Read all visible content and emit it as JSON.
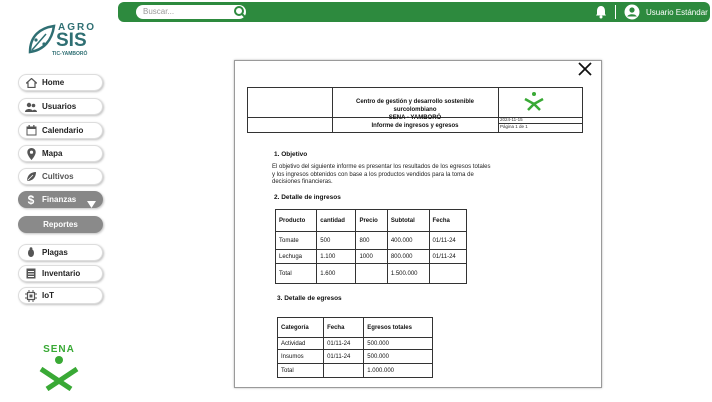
{
  "topbar": {
    "search_placeholder": "Buscar...",
    "user_name": "Usuario Estándar",
    "accent_color": "#2d8a3e"
  },
  "logo": {
    "agro": "AGRO",
    "sis": "SIS",
    "tic": "TIC-YAMBORÓ"
  },
  "sidebar": {
    "items": [
      {
        "label": "Home",
        "icon": "home-icon"
      },
      {
        "label": "Usuarios",
        "icon": "users-icon"
      },
      {
        "label": "Calendario",
        "icon": "calendar-icon"
      },
      {
        "label": "Mapa",
        "icon": "map-pin-icon"
      },
      {
        "label": "Cultivos",
        "icon": "leaf-icon"
      },
      {
        "label": "Finanzas",
        "icon": "dollar-icon"
      },
      {
        "label": "Reportes",
        "icon": ""
      },
      {
        "label": "Plagas",
        "icon": "bug-icon"
      },
      {
        "label": "Inventario",
        "icon": "inventory-icon"
      },
      {
        "label": "IoT",
        "icon": "chip-icon"
      }
    ]
  },
  "sena_logo_text": "SENA",
  "document": {
    "header_center": "Centro de gestión y desarrollo sostenible surcolombiano",
    "header_center2": "SENA - YAMBORÓ",
    "header_report": "Informe de ingresos y egresos",
    "header_date": "2024-11-15",
    "header_page": "Página 1 de 1",
    "sec1_title": "1. Objetivo",
    "sec1_text": "El objetivo del siguiente informe es presentar los resultados de los egresos totales y los ingresos obtenidos con base a los productos vendidos para la toma de decisiones financieras.",
    "sec2_title": "2. Detalle de ingresos",
    "ingresos": {
      "headers": [
        "Producto",
        "cantidad",
        "Precio",
        "Subtotal",
        "Fecha"
      ],
      "rows": [
        [
          "Tomate",
          "500",
          "800",
          "400.000",
          "01/11-24"
        ],
        [
          "Lechuga",
          "1.100",
          "1000",
          "800.000",
          "01/11-24"
        ],
        [
          "Total",
          "1.600",
          "",
          "1.500.000",
          ""
        ]
      ]
    },
    "sec3_title": "3. Detalle de egresos",
    "egresos": {
      "headers": [
        "Categoría",
        "Fecha",
        "Egresos totales"
      ],
      "rows": [
        [
          "Actividad",
          "01/11-24",
          "500.000"
        ],
        [
          "Insumos",
          "01/11-24",
          "500.000"
        ],
        [
          "Total",
          "",
          "1.000.000"
        ]
      ]
    }
  }
}
